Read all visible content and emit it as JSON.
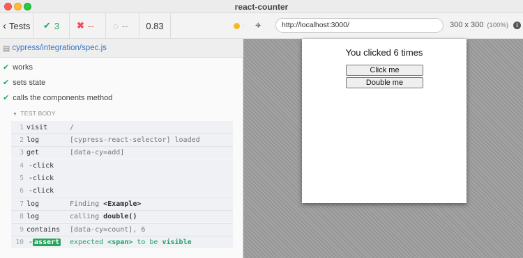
{
  "window": {
    "title": "react-counter"
  },
  "stats": {
    "tests_label": "Tests",
    "passed": "3",
    "failed": "--",
    "pending": "--",
    "duration": "0.83"
  },
  "spec": {
    "path": "cypress/integration/spec.js"
  },
  "tests": [
    {
      "title": "works"
    },
    {
      "title": "sets state"
    },
    {
      "title": "calls the components method"
    }
  ],
  "test_body": {
    "header": "TEST BODY",
    "commands": [
      {
        "num": "1",
        "name": "visit",
        "message": "/"
      },
      {
        "num": "2",
        "name": "log",
        "message": "[cypress-react-selector] loaded"
      },
      {
        "num": "3",
        "name": "get",
        "message": "[data-cy=add]"
      },
      {
        "num": "4",
        "name": "-click",
        "message": ""
      },
      {
        "num": "5",
        "name": "-click",
        "message": ""
      },
      {
        "num": "6",
        "name": "-click",
        "message": ""
      },
      {
        "num": "7",
        "name": "log",
        "message_prefix": "Finding ",
        "message_bold": "<Example>"
      },
      {
        "num": "8",
        "name": "log",
        "message_prefix": "calling ",
        "message_bold": "double()"
      },
      {
        "num": "9",
        "name": "contains",
        "message": "[data-cy=count], 6"
      },
      {
        "num": "10",
        "name": "assert",
        "message_a": "expected ",
        "message_b": "<span>",
        "message_c": " to be ",
        "message_d": "visible"
      }
    ]
  },
  "browser": {
    "url": "http://localhost:3000/",
    "viewport": "300 x 300",
    "viewport_pct": "(100%)"
  },
  "app": {
    "count_text": "You clicked 6 times",
    "click_button": "Click me",
    "double_button": "Double me"
  },
  "colors": {
    "pass": "#26a65b",
    "fail": "#e94f5f",
    "link": "#3a76c2",
    "running": "#f5b921"
  },
  "icons": {
    "back": "chevron-left-icon",
    "passed": "check-icon",
    "failed": "x-icon",
    "pending": "circle-notch-icon",
    "reload": "reload-icon",
    "selector": "crosshair-icon",
    "info": "info-icon",
    "file": "file-icon"
  }
}
